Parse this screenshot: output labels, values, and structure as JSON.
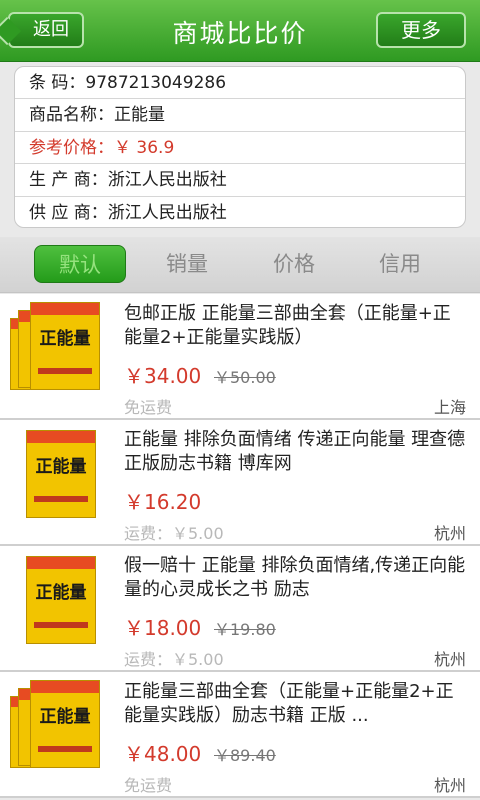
{
  "header": {
    "title": "商城比比价",
    "back_label": "返回",
    "more_label": "更多"
  },
  "info": [
    {
      "text": "条 码：9787213049286",
      "highlight": false
    },
    {
      "text": "商品名称：正能量",
      "highlight": false
    },
    {
      "text": "参考价格：￥ 36.9",
      "highlight": true
    },
    {
      "text": "生 产 商：浙江人民出版社",
      "highlight": false
    },
    {
      "text": "供 应 商：浙江人民出版社",
      "highlight": false
    }
  ],
  "sort_tabs": [
    {
      "label": "默认",
      "active": true
    },
    {
      "label": "销量",
      "active": false
    },
    {
      "label": "价格",
      "active": false
    },
    {
      "label": "信用",
      "active": false
    }
  ],
  "products": [
    {
      "title": "包邮正版 正能量三部曲全套（正能量+正能量2+正能量实践版）",
      "price": "￥34.00",
      "old_price": "￥50.00",
      "shipping": "免运费",
      "city": "上海",
      "cover_text": "正能量"
    },
    {
      "title": "正能量 排除负面情绪 传递正向能量 理查德 正版励志书籍 博库网",
      "price": "￥16.20",
      "old_price": "",
      "shipping": "运费：￥5.00",
      "city": "杭州",
      "cover_text": "正能量"
    },
    {
      "title": "假一赔十 正能量 排除负面情绪,传递正向能量的心灵成长之书 励志",
      "price": "￥18.00",
      "old_price": "￥19.80",
      "shipping": "运费：￥5.00",
      "city": "杭州",
      "cover_text": "正能量"
    },
    {
      "title": "正能量三部曲全套（正能量+正能量2+正能量实践版）励志书籍 正版 ...",
      "price": "￥48.00",
      "old_price": "￥89.40",
      "shipping": "免运费",
      "city": "杭州",
      "cover_text": "正能量"
    }
  ],
  "colors": {
    "header_green": "#2f9a22",
    "price_red": "#d33a2c"
  }
}
